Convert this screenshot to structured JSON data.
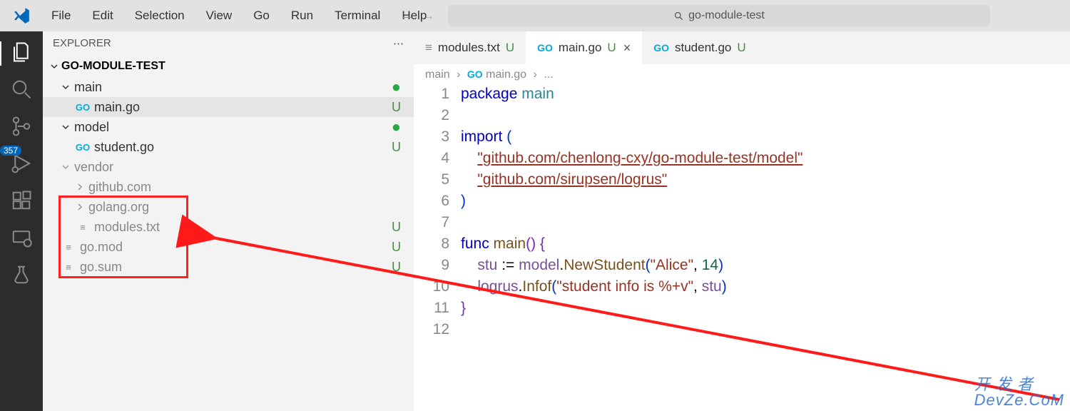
{
  "menu": {
    "file": "File",
    "edit": "Edit",
    "selection": "Selection",
    "view": "View",
    "go": "Go",
    "run": "Run",
    "terminal": "Terminal",
    "help": "Help"
  },
  "search": {
    "text": "go-module-test"
  },
  "activity": {
    "badge": "357"
  },
  "explorer": {
    "title": "EXPLORER",
    "root": "GO-MODULE-TEST",
    "tree": [
      {
        "kind": "folder",
        "open": true,
        "name": "main",
        "marker": "dot",
        "indent": 1
      },
      {
        "kind": "go",
        "name": "main.go",
        "marker": "U",
        "indent": 2,
        "selected": true
      },
      {
        "kind": "folder",
        "open": true,
        "name": "model",
        "marker": "dot",
        "indent": 1
      },
      {
        "kind": "go",
        "name": "student.go",
        "marker": "U",
        "indent": 2
      },
      {
        "kind": "folder",
        "open": true,
        "name": "vendor",
        "marker": "",
        "indent": 1,
        "dim": true
      },
      {
        "kind": "folder",
        "open": false,
        "name": "github.com",
        "marker": "",
        "indent": 2,
        "dim": true
      },
      {
        "kind": "folder",
        "open": false,
        "name": "golang.org",
        "marker": "",
        "indent": 2,
        "dim": true
      },
      {
        "kind": "text",
        "name": "modules.txt",
        "marker": "U",
        "indent": 2,
        "dim": true
      },
      {
        "kind": "text",
        "name": "go.mod",
        "marker": "U",
        "indent": 1,
        "dim": true
      },
      {
        "kind": "text",
        "name": "go.sum",
        "marker": "U",
        "indent": 1,
        "dim": true
      }
    ]
  },
  "tabs": [
    {
      "icon": "txt",
      "label": "modules.txt",
      "mod": "U",
      "active": false
    },
    {
      "icon": "go",
      "label": "main.go",
      "mod": "U",
      "active": true,
      "close": true
    },
    {
      "icon": "go",
      "label": "student.go",
      "mod": "U",
      "active": false
    }
  ],
  "crumbs": {
    "a": "main",
    "b": "main.go",
    "c": "..."
  },
  "code": {
    "lines": 12
  },
  "watermark": {
    "l1": "开 发 者",
    "l2": "DevZe.CoM"
  }
}
